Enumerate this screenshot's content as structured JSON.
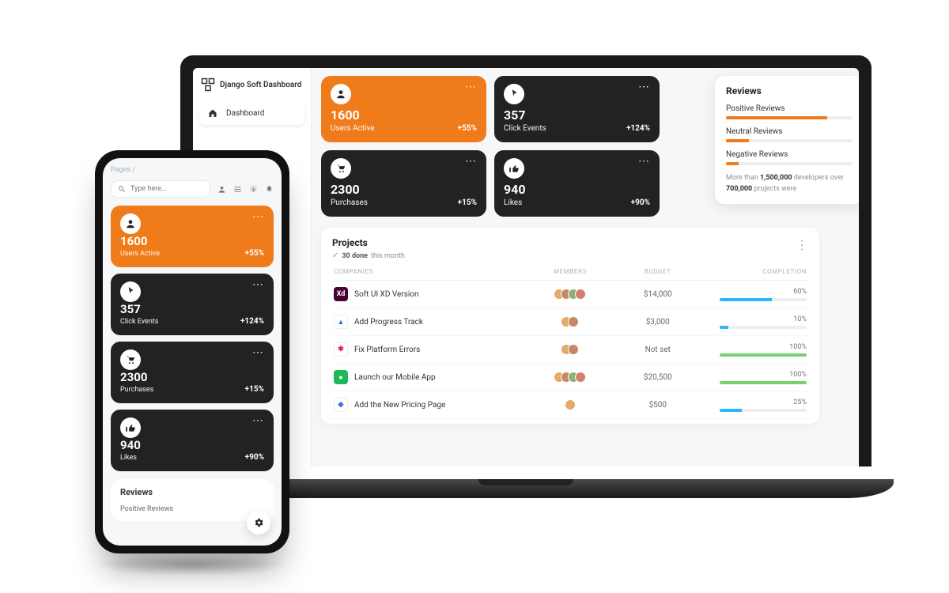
{
  "brand": {
    "title": "Django Soft Dashboard"
  },
  "nav": {
    "dashboard": "Dashboard"
  },
  "breadcrumb": {
    "root": "Pages",
    "sep": "/"
  },
  "search": {
    "placeholder": "Type here..."
  },
  "stats": {
    "users": {
      "value": "1600",
      "label": "Users Active",
      "delta": "+55%"
    },
    "clicks": {
      "value": "357",
      "label": "Click Events",
      "delta": "+124%"
    },
    "purchases": {
      "value": "2300",
      "label": "Purchases",
      "delta": "+15%"
    },
    "likes": {
      "value": "940",
      "label": "Likes",
      "delta": "+90%"
    }
  },
  "reviews": {
    "title": "Reviews",
    "positive": {
      "label": "Positive Reviews",
      "pct": 80
    },
    "neutral": {
      "label": "Neutral Reviews",
      "pct": 18
    },
    "negative": {
      "label": "Negative Reviews",
      "pct": 10
    },
    "note_pre": "More than ",
    "note_b1": "1,500,000",
    "note_mid": " developers over ",
    "note_b2": "700,000",
    "note_post": " projects were"
  },
  "projects": {
    "title": "Projects",
    "done_count": "30 done",
    "done_suffix": "this month",
    "headers": {
      "companies": "COMPANIES",
      "members": "MEMBERS",
      "budget": "BUDGET",
      "completion": "COMPLETION"
    },
    "rows": [
      {
        "name": "Soft UI XD Version",
        "budget": "$14,000",
        "pct": 60,
        "bar": "#2bb7ff",
        "icon_bg": "#470137",
        "icon_txt": "Xd",
        "members": [
          "#e6a96b",
          "#c38b63",
          "#8fb07a",
          "#d67f6a"
        ]
      },
      {
        "name": "Add Progress Track",
        "budget": "$3,000",
        "pct": 10,
        "bar": "#2bb7ff",
        "icon_bg": "#ffffff",
        "icon_txt": "▲",
        "icon_fg": "#2e6df6",
        "members": [
          "#e6a96b",
          "#c38b63"
        ]
      },
      {
        "name": "Fix Platform Errors",
        "budget": "Not set",
        "pct": 100,
        "bar": "#74d36b",
        "icon_bg": "#ffffff",
        "icon_txt": "✱",
        "icon_fg": "#e01e5a",
        "members": [
          "#e6a96b",
          "#c38b63"
        ]
      },
      {
        "name": "Launch our Mobile App",
        "budget": "$20,500",
        "pct": 100,
        "bar": "#74d36b",
        "icon_bg": "#1db954",
        "icon_txt": "●",
        "icon_fg": "#ffffff",
        "members": [
          "#e6a96b",
          "#c38b63",
          "#8fb07a",
          "#d67f6a"
        ]
      },
      {
        "name": "Add the New Pricing Page",
        "budget": "$500",
        "pct": 25,
        "bar": "#2bb7ff",
        "icon_bg": "#ffffff",
        "icon_txt": "◆",
        "icon_fg": "#2e6df6",
        "members": [
          "#e6a96b"
        ]
      }
    ]
  }
}
